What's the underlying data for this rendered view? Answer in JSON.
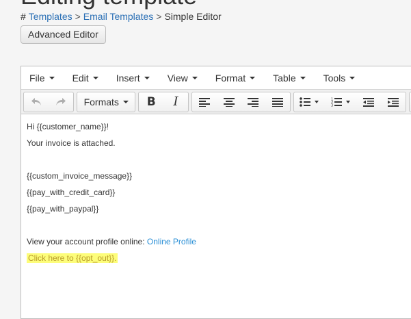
{
  "page": {
    "title": "Editing template",
    "breadcrumb": {
      "hash": "#",
      "items": [
        "Templates",
        "Email Templates",
        "Simple Editor"
      ],
      "separator": ">"
    },
    "advanced_editor_label": "Advanced Editor"
  },
  "editor": {
    "menubar": [
      {
        "label": "File"
      },
      {
        "label": "Edit"
      },
      {
        "label": "Insert"
      },
      {
        "label": "View"
      },
      {
        "label": "Format"
      },
      {
        "label": "Table"
      },
      {
        "label": "Tools"
      }
    ],
    "toolbar": {
      "formats_label": "Formats",
      "bold_glyph": "B",
      "italic_glyph": "I"
    },
    "content": {
      "line1": "Hi {{customer_name}}!",
      "line2": "Your invoice is attached.",
      "line3": "{{custom_invoice_message}}",
      "line4": "{{pay_with_credit_card}}",
      "line5": "{{pay_with_paypal}}",
      "profile_prefix": "View your account profile online: ",
      "profile_link": "Online Profile",
      "opt_out": "Click here to {{opt_out}}."
    }
  },
  "colors": {
    "link": "#2a6fb5",
    "content_link": "#2a8fd6",
    "highlight_bg": "#fdfd7a",
    "highlight_text": "#b89b2a"
  }
}
